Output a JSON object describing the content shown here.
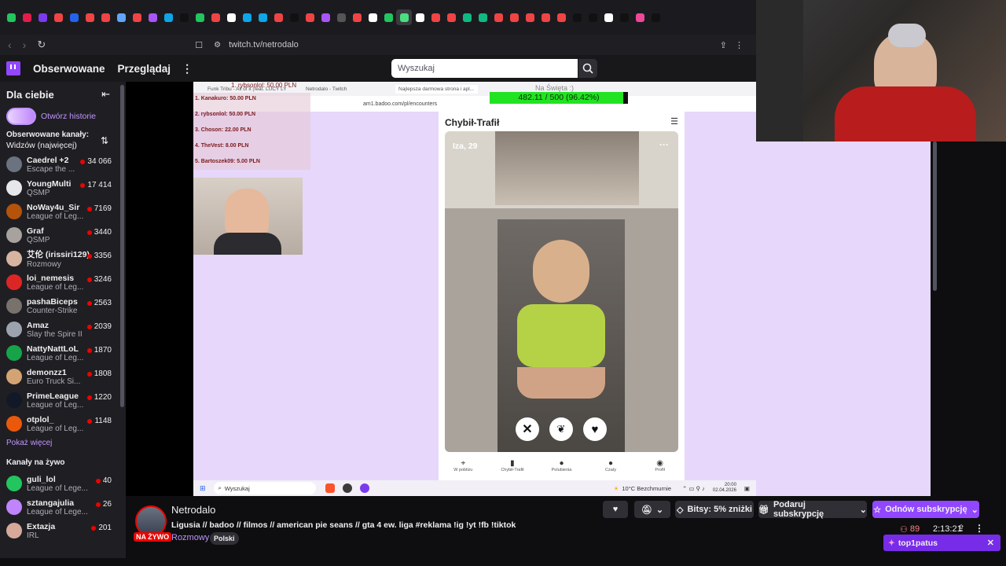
{
  "browser": {
    "url": "twitch.tv/netrodalo",
    "tab_icon_colors": [
      "#22c55e",
      "#e11d48",
      "#7c3aed",
      "#ef4444",
      "#2563eb",
      "#ef4444",
      "#ef4444",
      "#60a5fa",
      "#ef4444",
      "#a855f7",
      "#0ea5e9",
      "#111111",
      "#22c55e",
      "#ef4444",
      "#ffffff",
      "#0ea5e9",
      "#0ea5e9",
      "#ef4444",
      "#111111",
      "#ef4444",
      "#a855f7",
      "#555555",
      "#ef4444",
      "#ffffff",
      "#22c55e",
      "#4ade80",
      "#ffffff",
      "#ef4444",
      "#ef4444",
      "#10b981",
      "#10b981",
      "#ef4444",
      "#ef4444",
      "#ef4444",
      "#ef4444",
      "#ef4444",
      "#111111",
      "#111111",
      "#ffffff",
      "#111111",
      "#ec4899",
      "#111111"
    ]
  },
  "twitch": {
    "nav_following": "Obserwowane",
    "nav_browse": "Przeglądaj",
    "search_placeholder": "Wyszukaj"
  },
  "sidebar": {
    "for_you": "Dla ciebie",
    "open_stories": "Otwórz historie",
    "followed_title": "Obserwowane kanały:",
    "followed_sort": "Widzów (najwięcej)",
    "channels": [
      {
        "name": "Caedrel +2",
        "game": "Escape the ...",
        "viewers": "34 066",
        "color": "#6b7280"
      },
      {
        "name": "YoungMulti",
        "game": "QSMP",
        "viewers": "17 414",
        "color": "#e5e7eb"
      },
      {
        "name": "NoWay4u_Sir",
        "game": "League of Leg...",
        "viewers": "7169",
        "color": "#b45309"
      },
      {
        "name": "Graf",
        "game": "QSMP",
        "viewers": "3440",
        "color": "#a8a29e"
      },
      {
        "name": "艾伦 (irissiri129)",
        "game": "Rozmowy",
        "viewers": "3356",
        "color": "#d6b4a0"
      },
      {
        "name": "loi_nemesis",
        "game": "League of Leg...",
        "viewers": "3246",
        "color": "#dc2626"
      },
      {
        "name": "pashaBiceps",
        "game": "Counter-Strike",
        "viewers": "2563",
        "color": "#78716c"
      },
      {
        "name": "Amaz",
        "game": "Slay the Spire II",
        "viewers": "2039",
        "color": "#9ca3af"
      },
      {
        "name": "NattyNattLoL",
        "game": "League of Leg...",
        "viewers": "1870",
        "color": "#16a34a"
      },
      {
        "name": "demonzz1",
        "game": "Euro Truck Si...",
        "viewers": "1808",
        "color": "#d4a373"
      },
      {
        "name": "PrimeLeague",
        "game": "League of Leg...",
        "viewers": "1220",
        "color": "#111827"
      },
      {
        "name": "otplol_",
        "game": "League of Leg...",
        "viewers": "1148",
        "color": "#ea580c"
      }
    ],
    "show_more": "Pokaż więcej",
    "live_title": "Kanały na żywo",
    "live": [
      {
        "name": "guli_lol",
        "game": "League of Lege...",
        "viewers": "40",
        "color": "#22c55e"
      },
      {
        "name": "sztangajulia",
        "game": "League of Lege...",
        "viewers": "26",
        "color": "#c084fc"
      },
      {
        "name": "Extazja",
        "game": "IRL",
        "viewers": "201",
        "color": "#d6a99a"
      }
    ]
  },
  "overlay": {
    "tab1": "Funk Tribu - All of it (feat. LUCY LY)...",
    "tab2": "Netrodalo - Twitch",
    "tab3": "Najlepsza darmowa strona i apl...",
    "inner_url": "am1.badoo.com/pl/encounters",
    "goal_label": "Na Święta :)",
    "goal_text": "482.11 / 500 (96.42%)",
    "goal_percent": 0.9642,
    "donor_top": "1. rybsonlol: 50.00 PLN",
    "donors": [
      "1. Kanakuro: 50.00 PLN",
      "2. rybsonlol: 50.00 PLN",
      "3. Choson: 22.00 PLN",
      "4. TheVest: 8.00 PLN",
      "5. Bartoszek09: 5.00 PLN"
    ],
    "page_title": "Chybił-Trafił",
    "profile_name": "Iza, 29",
    "bottom_nav": [
      "W pobliżu",
      "Chybił-Trafił",
      "Polubienia",
      "Czaty",
      "Profil"
    ],
    "taskbar_search": "Wyszukaj",
    "weather": "10°C  Bezchmurnie",
    "clock_time": "20:00",
    "clock_date": "02.04.2026"
  },
  "stream_info": {
    "streamer": "Netrodalo",
    "live_badge": "NA ŻYWO",
    "title": "Ligusia // badoo // filmos // american pie seans // gta 4 ew. liga #reklama !ig !yt !fb !tiktok",
    "category": "Rozmowy",
    "tag": "Polski",
    "bits_button": "Bitsy: 5% zniżki",
    "gift_button": "Podaruj subskrypcję",
    "resub_button": "Odnów subskrypcję",
    "viewers": "89",
    "uptime": "2:13:21",
    "toast_user": "top1patus"
  }
}
